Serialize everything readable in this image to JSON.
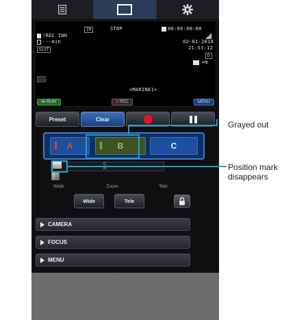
{
  "tabs": [
    {
      "name": "list-icon",
      "active": false
    },
    {
      "name": "screen-icon",
      "active": true
    },
    {
      "name": "gear-icon",
      "active": false
    }
  ],
  "monitor": {
    "im_badge": "IM",
    "stop": "STOP",
    "timecode": "00:00:00:00",
    "rec_inh": "!REC INH",
    "remaining": "---min",
    "date": "02-01-2018",
    "time": "21:53:12",
    "slot": "SLOT",
    "d_badge": "D",
    "infinity_m": "∞m",
    "camera_name": "<MARINE1>",
    "play_label": "PLAY",
    "rec_label": "REC",
    "menu_label": "MENU"
  },
  "controls": {
    "preset": "Preset",
    "clear": "Clear",
    "a": "A",
    "b": "B",
    "c": "C",
    "strip_label_top": "C",
    "strip_label_bottom": "B",
    "zoom": {
      "wide_label": "Wide",
      "zoom_label": "Zoom",
      "tele_label": "Tele"
    },
    "wide_button": "Wide",
    "tele_button": "Tele"
  },
  "menus": [
    "CAMERA",
    "FOCUS",
    "MENU"
  ],
  "callouts": {
    "grayed_out": "Grayed out",
    "position_line1": "Position mark",
    "position_line2": "disappears"
  },
  "colors": {
    "accent_blue": "#1f9fd1",
    "rec_red": "#e8102a",
    "mark_orange": "#e8471a",
    "mark_green": "#55c42a"
  }
}
